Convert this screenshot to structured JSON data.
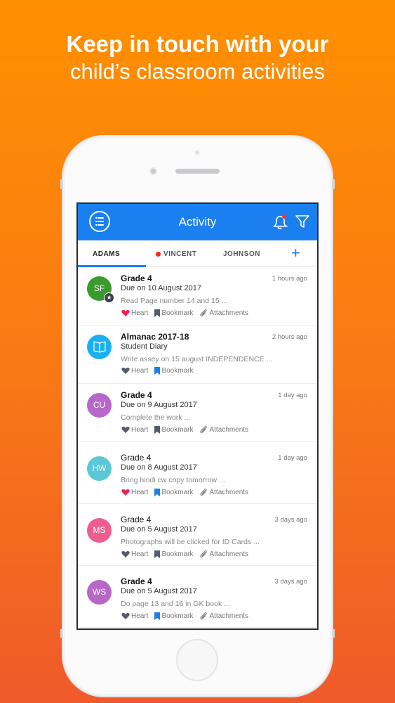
{
  "headline": {
    "line1": "Keep in touch with your",
    "line2": "child’s classroom activities"
  },
  "app": {
    "title": "Activity",
    "icons": {
      "menu": "list-circle-icon",
      "notifications": "bell-icon",
      "filter": "funnel-icon"
    },
    "accent": "#1a80f0"
  },
  "tabs": [
    {
      "label": "ADAMS",
      "active": true
    },
    {
      "label": "VINCENT",
      "unread_dot": true
    },
    {
      "label": "JOHNSON"
    }
  ],
  "add_label": "+",
  "items": [
    {
      "avatar": "SF",
      "color": "#3a9a2e",
      "title": "Grade 4",
      "bold": true,
      "time": "1 hours ago",
      "subtitle": "Due on 10 August 2017",
      "preview": "Read Page number 14 and 15 ...",
      "heart": "Heart",
      "bookmark": "Bookmark",
      "attachments": "Attachments",
      "hearted": true,
      "bookmarked": false,
      "star": true
    },
    {
      "avatar": "",
      "color": "#1ab0f0",
      "title": "Almanac 2017-18",
      "bold": true,
      "time": "2 hours ago",
      "subtitle": "Student Diary",
      "preview": "Write assey on 15 august INDEPENDENCE ...",
      "heart": "Heart",
      "bookmark": "Bookmark",
      "hearted": false,
      "bookmarked": true,
      "book_icon": true
    },
    {
      "avatar": "CU",
      "color": "#b767c8",
      "title": "Grade 4",
      "bold": true,
      "time": "1 day ago",
      "subtitle": "Due on 9 August 2017",
      "preview": "Complete the work ...",
      "heart": "Heart",
      "bookmark": "Bookmark",
      "attachments": "Attachments",
      "hearted": false,
      "bookmarked": false
    },
    {
      "avatar": "HW",
      "color": "#5bc8d8",
      "title": "Grade 4",
      "bold": false,
      "time": "1 day ago",
      "subtitle": "Due on 8 August 2017",
      "preview": "Bring hindi cw copy tomorrow ...",
      "heart": "Heart",
      "bookmark": "Bookmark",
      "attachments": "Attachments",
      "hearted": true,
      "bookmarked": true
    },
    {
      "avatar": "MS",
      "color": "#ee5d8f",
      "title": "Grade 4",
      "bold": false,
      "time": "3 days ago",
      "subtitle": "Due on 5 August 2017",
      "preview": "Photographs will be clicked for ID Cards ...",
      "heart": "Heart",
      "bookmark": "Bookmark",
      "attachments": "Attachments",
      "hearted": false,
      "bookmarked": false
    },
    {
      "avatar": "WS",
      "color": "#b767c8",
      "title": "Grade 4",
      "bold": true,
      "time": "3 days ago",
      "subtitle": "Due on 5 August 2017",
      "preview": "Do page 13 and 16 in GK book ...",
      "heart": "Heart",
      "bookmark": "Bookmark",
      "attachments": "Attachments",
      "hearted": false,
      "bookmarked": true
    }
  ]
}
